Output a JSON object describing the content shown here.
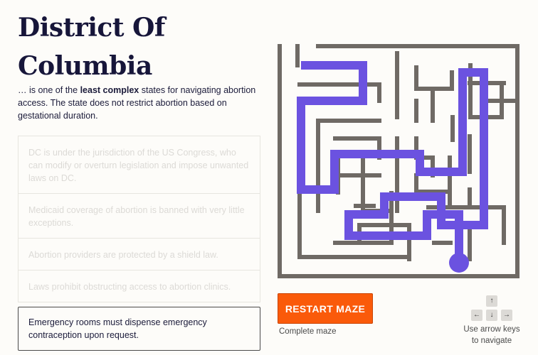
{
  "state": {
    "title_line1": "District Of",
    "title_line2": "Columbia",
    "intro_prefix": "… is one of the ",
    "intro_bold": "least complex",
    "intro_suffix": " states for navigating abortion access. The state does not restrict abortion based on gestational duration."
  },
  "facts": [
    {
      "text": "DC is under the jurisdiction of the US Congress, who can modify or overturn legislation and impose unwanted laws on DC.",
      "revealed": false
    },
    {
      "text": "Medicaid coverage of abortion is banned with very little exceptions.",
      "revealed": false
    },
    {
      "text": "Abortion providers are protected by a shield law.",
      "revealed": false
    },
    {
      "text": "Laws prohibit obstructing access to abortion clinics.",
      "revealed": false
    },
    {
      "text": "Emergency rooms must dispense emergency contraception upon request.",
      "revealed": true
    }
  ],
  "controls": {
    "restart_label": "RESTART MAZE",
    "status_text": "Complete maze",
    "help_text": "Use arrow keys to navigate",
    "keys": {
      "up": "↑",
      "left": "←",
      "down": "↓",
      "right": "→"
    }
  },
  "colors": {
    "wall": "#6f6a65",
    "path": "#6b52e0",
    "accent": "#fa5a0a"
  }
}
